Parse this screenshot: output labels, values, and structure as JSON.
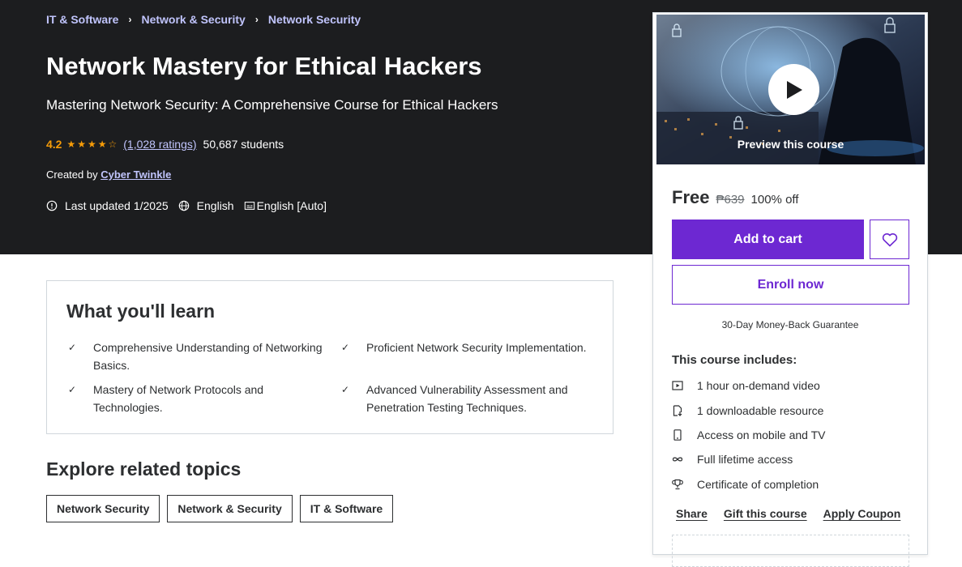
{
  "breadcrumb": [
    "IT & Software",
    "Network & Security",
    "Network Security"
  ],
  "course": {
    "title": "Network Mastery for Ethical Hackers",
    "subtitle": "Mastering Network Security: A Comprehensive Course for Ethical Hackers",
    "rating": "4.2",
    "rating_stars": 4.2,
    "ratings_count": "(1,028 ratings)",
    "students": "50,687 students",
    "created_by_label": "Created by",
    "author": "Cyber Twinkle",
    "last_updated": "Last updated 1/2025",
    "language": "English",
    "captions": "English [Auto]"
  },
  "learn": {
    "heading": "What you'll learn",
    "items": [
      "Comprehensive Understanding of Networking Basics.",
      "Proficient Network Security Implementation.",
      "Mastery of Network Protocols and Technologies.",
      "Advanced Vulnerability Assessment and Penetration Testing Techniques."
    ]
  },
  "explore": {
    "heading": "Explore related topics",
    "tags": [
      "Network Security",
      "Network & Security",
      "IT & Software"
    ]
  },
  "sidebar": {
    "preview_label": "Preview this course",
    "price": "Free",
    "original_price": "₱639",
    "discount": "100% off",
    "add_to_cart": "Add to cart",
    "enroll": "Enroll now",
    "guarantee": "30-Day Money-Back Guarantee",
    "includes_title": "This course includes:",
    "includes": [
      {
        "icon": "video-icon",
        "text": "1 hour on-demand video"
      },
      {
        "icon": "file-download-icon",
        "text": "1 downloadable resource"
      },
      {
        "icon": "mobile-icon",
        "text": "Access on mobile and TV"
      },
      {
        "icon": "infinity-icon",
        "text": "Full lifetime access"
      },
      {
        "icon": "trophy-icon",
        "text": "Certificate of completion"
      }
    ],
    "links": [
      "Share",
      "Gift this course",
      "Apply Coupon"
    ]
  },
  "colors": {
    "hero_bg": "#1c1d1f",
    "link_purple": "#c0c4fc",
    "primary": "#6d28d2",
    "star": "#f69c08"
  }
}
